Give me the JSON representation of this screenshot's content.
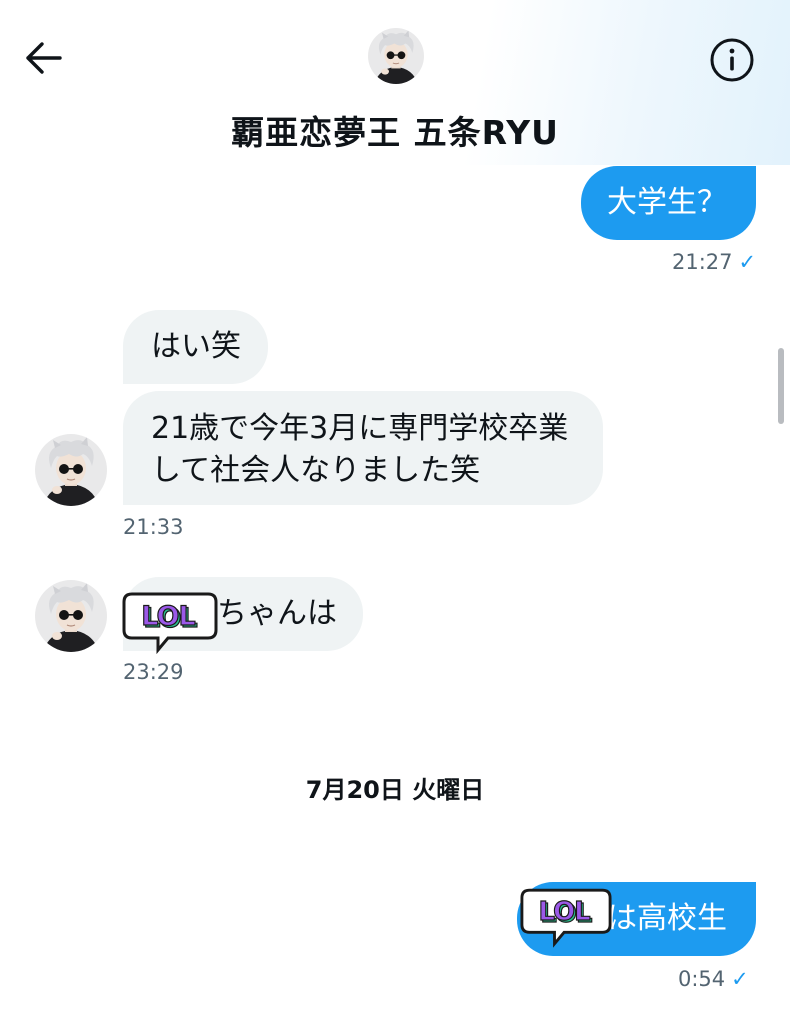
{
  "header": {
    "contact_name": "覇亜恋夢王 五条RYU",
    "back_icon": "arrow-left-icon",
    "info_icon": "info-circle-icon"
  },
  "messages": [
    {
      "direction": "out",
      "text": "大学生？",
      "time": "21:27",
      "read_check": "✓"
    },
    {
      "direction": "in",
      "lines": [
        "はい笑",
        "21歳で今年3月に専門学校卒業",
        "して社会人なりました笑"
      ],
      "time": "21:33"
    },
    {
      "direction": "in",
      "text": "ちゃんは",
      "sticker": "LOL",
      "time": "23:29"
    },
    {
      "direction": "out",
      "text": "は高校生",
      "sticker": "LOL",
      "time": "0:54",
      "read_check": "✓"
    }
  ],
  "date_separator": "7月20日 火曜日",
  "colors": {
    "outgoing_bubble": "#1d9bf0",
    "incoming_bubble": "#eff3f4",
    "timestamp": "#536471",
    "sticker_purple": "#9b59e8",
    "sticker_green": "#2bbf8e"
  }
}
